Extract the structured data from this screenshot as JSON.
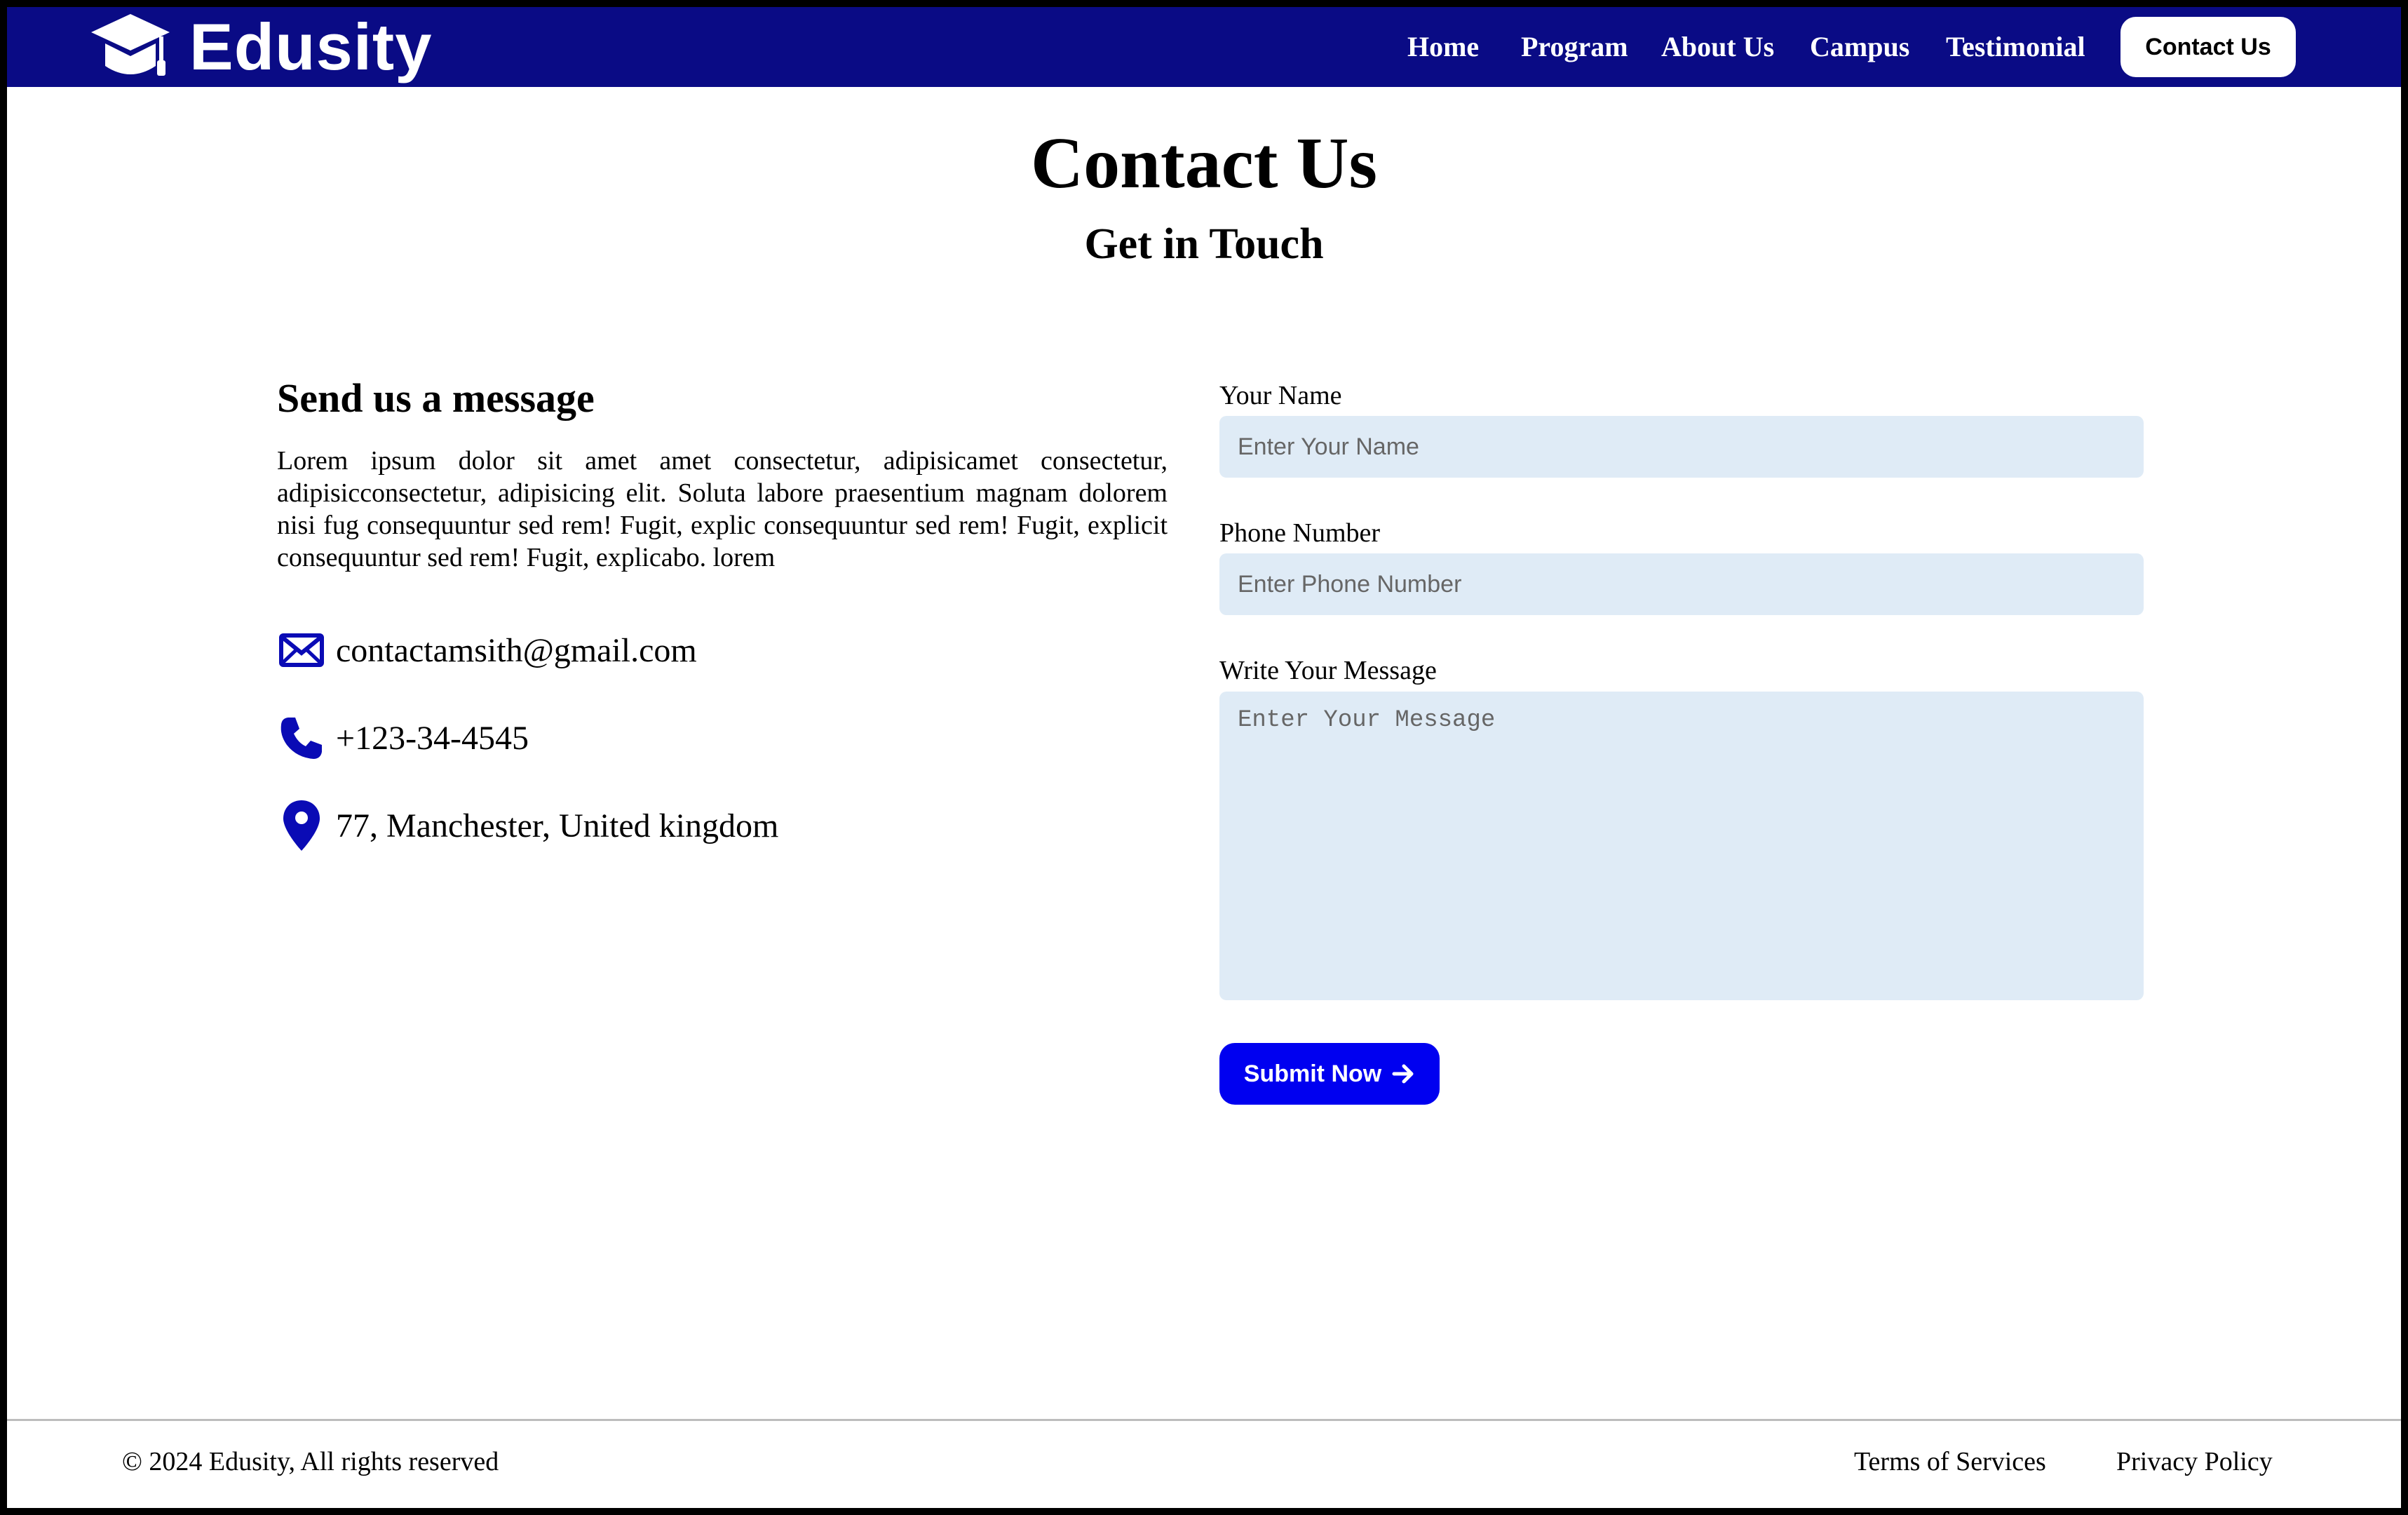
{
  "brand": {
    "name": "Edusity"
  },
  "nav": {
    "items": [
      {
        "label": "Home"
      },
      {
        "label": "Program"
      },
      {
        "label": "About Us"
      },
      {
        "label": "Campus"
      },
      {
        "label": "Testimonial"
      }
    ],
    "cta_label": "Contact Us"
  },
  "header": {
    "title": "Contact Us",
    "subtitle": "Get in Touch"
  },
  "info": {
    "heading": "Send us a message",
    "description": "Lorem ipsum dolor sit amet amet consectetur, adipisicamet consectetur, adipisicconsectetur, adipisicing elit. Soluta labore praesentium magnam dolorem nisi fug consequuntur sed rem! Fugit, explic consequuntur sed rem! Fugit, explicit consequuntur sed rem! Fugit, explicabo. lorem",
    "email": "contactamsith@gmail.com",
    "phone": "+123-34-4545",
    "address": "77, Manchester, United kingdom"
  },
  "form": {
    "name_label": "Your Name",
    "name_placeholder": "Enter Your Name",
    "phone_label": "Phone Number",
    "phone_placeholder": "Enter Phone Number",
    "message_label": "Write Your Message",
    "message_placeholder": "Enter Your Message",
    "submit_label": "Submit Now"
  },
  "footer": {
    "copyright": "© 2024 Edusity, All rights reserved",
    "terms_label": "Terms of Services",
    "privacy_label": "Privacy Policy"
  },
  "colors": {
    "navbar_bg": "#0a0b85",
    "accent_button": "#0000f0",
    "input_bg": "#dfebf6",
    "icon_color": "#0a0bb5"
  },
  "icons": {
    "logo": "graduation-cap-icon",
    "email": "envelope-icon",
    "phone": "phone-icon",
    "address": "location-pin-icon",
    "submit": "arrow-right-icon"
  }
}
